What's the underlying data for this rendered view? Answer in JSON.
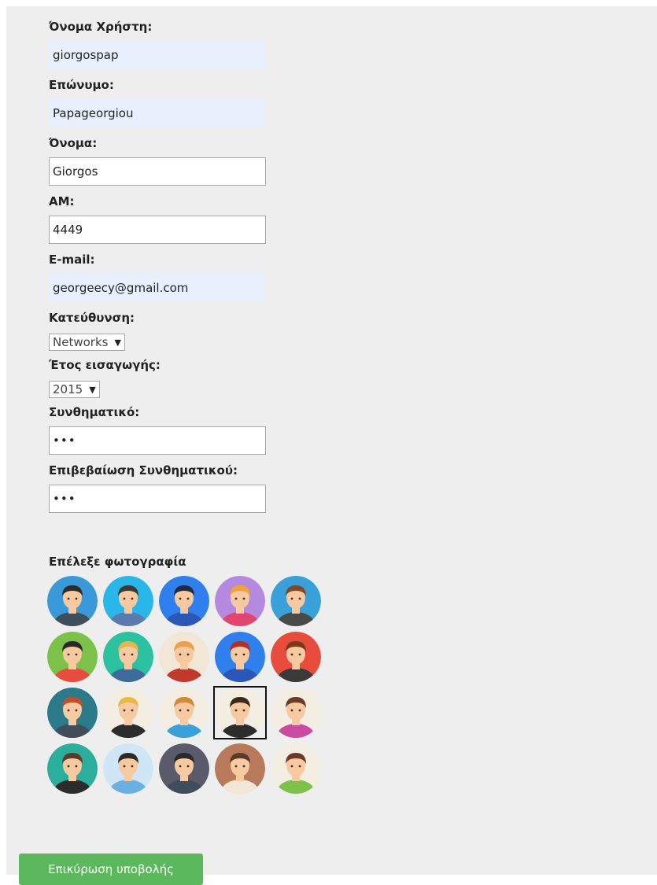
{
  "form": {
    "username": {
      "label": "Όνομα Χρήστη:",
      "value": "giorgospap"
    },
    "surname": {
      "label": "Επώνυμο:",
      "value": "Papageorgiou"
    },
    "firstname": {
      "label": "Όνομα:",
      "value": "Giorgos"
    },
    "am": {
      "label": "ΑΜ:",
      "value": "4449"
    },
    "email": {
      "label": "E-mail:",
      "value": "georgeecy@gmail.com"
    },
    "direction": {
      "label": "Κατεύθυνση:",
      "selected": "Networks",
      "arrow": "▼"
    },
    "year": {
      "label": "Έτος εισαγωγής:",
      "selected": "2015",
      "arrow": "▼"
    },
    "password": {
      "label": "Συνθηματικό:",
      "value": "•••"
    },
    "password_confirm": {
      "label": "Επιβεβαίωση Συνθηματικού:",
      "value": "•••"
    }
  },
  "photo": {
    "heading": "Επέλεξε φωτογραφία",
    "avatars": [
      {
        "bg": "#3a9ad9",
        "skin": "#f6c9a0",
        "hair": "#2c2c2c",
        "shirt": "#3f4e5a"
      },
      {
        "bg": "#29b6e8",
        "skin": "#f6c9a0",
        "hair": "#3a3a3a",
        "shirt": "#5a7bb0"
      },
      {
        "bg": "#2f80ed",
        "skin": "#f6c9a0",
        "hair": "#1f2a44",
        "shirt": "#2b57b8"
      },
      {
        "bg": "#b48ae0",
        "skin": "#f6c9a0",
        "hair": "#f2a03a",
        "shirt": "#e0466f"
      },
      {
        "bg": "#3aa0d9",
        "skin": "#f6c9a0",
        "hair": "#7b4a2a",
        "shirt": "#4a4a4a"
      },
      {
        "bg": "#7cc24a",
        "skin": "#f6c9a0",
        "hair": "#2a2a2a",
        "shirt": "#e84c3c"
      },
      {
        "bg": "#2cc1a0",
        "skin": "#f6c9a0",
        "hair": "#e0b84a",
        "shirt": "#3d6b9c"
      },
      {
        "bg": "#f2e6d6",
        "skin": "#f6c9a0",
        "hair": "#e8a04a",
        "shirt": "#c0392b"
      },
      {
        "bg": "#2f80ed",
        "skin": "#f6c9a0",
        "hair": "#b0302a",
        "shirt": "#2b57b8"
      },
      {
        "bg": "#e74c3c",
        "skin": "#f6c9a0",
        "hair": "#7a3a1a",
        "shirt": "#3a3a3a"
      },
      {
        "bg": "#2a7a8a",
        "skin": "#f6c9a0",
        "hair": "#c0502a",
        "shirt": "#3f4e5a"
      },
      {
        "bg": "#f4ede2",
        "skin": "#f6c9a0",
        "hair": "#e8b84a",
        "shirt": "#2c2c2c"
      },
      {
        "bg": "#f4ede2",
        "skin": "#f6c9a0",
        "hair": "#d08a3a",
        "shirt": "#3aa0d9"
      },
      {
        "bg": "#f4ede2",
        "skin": "#f6c9a0",
        "hair": "#3a2a1a",
        "shirt": "#2c2c2c"
      },
      {
        "bg": "#f4ede2",
        "skin": "#f6c9a0",
        "hair": "#6a3a2a",
        "shirt": "#c94aa0"
      },
      {
        "bg": "#2cae9c",
        "skin": "#f6c9a0",
        "hair": "#5a3a2a",
        "shirt": "#2c2c2c"
      },
      {
        "bg": "#cfe6f6",
        "skin": "#f6c9a0",
        "hair": "#2a2a2a",
        "shirt": "#6ab0e0"
      },
      {
        "bg": "#5a5a6a",
        "skin": "#f6c9a0",
        "hair": "#2a2a2a",
        "shirt": "#3f4e5a"
      },
      {
        "bg": "#b87a5a",
        "skin": "#f6c9a0",
        "hair": "#5a3a2a",
        "shirt": "#f2e6d6"
      },
      {
        "bg": "#f4ede2",
        "skin": "#f6c9a0",
        "hair": "#6a3a2a",
        "shirt": "#7cc24a"
      }
    ],
    "selected_index": 13
  },
  "submit": {
    "label": "Επικύρωση υποβολής"
  }
}
